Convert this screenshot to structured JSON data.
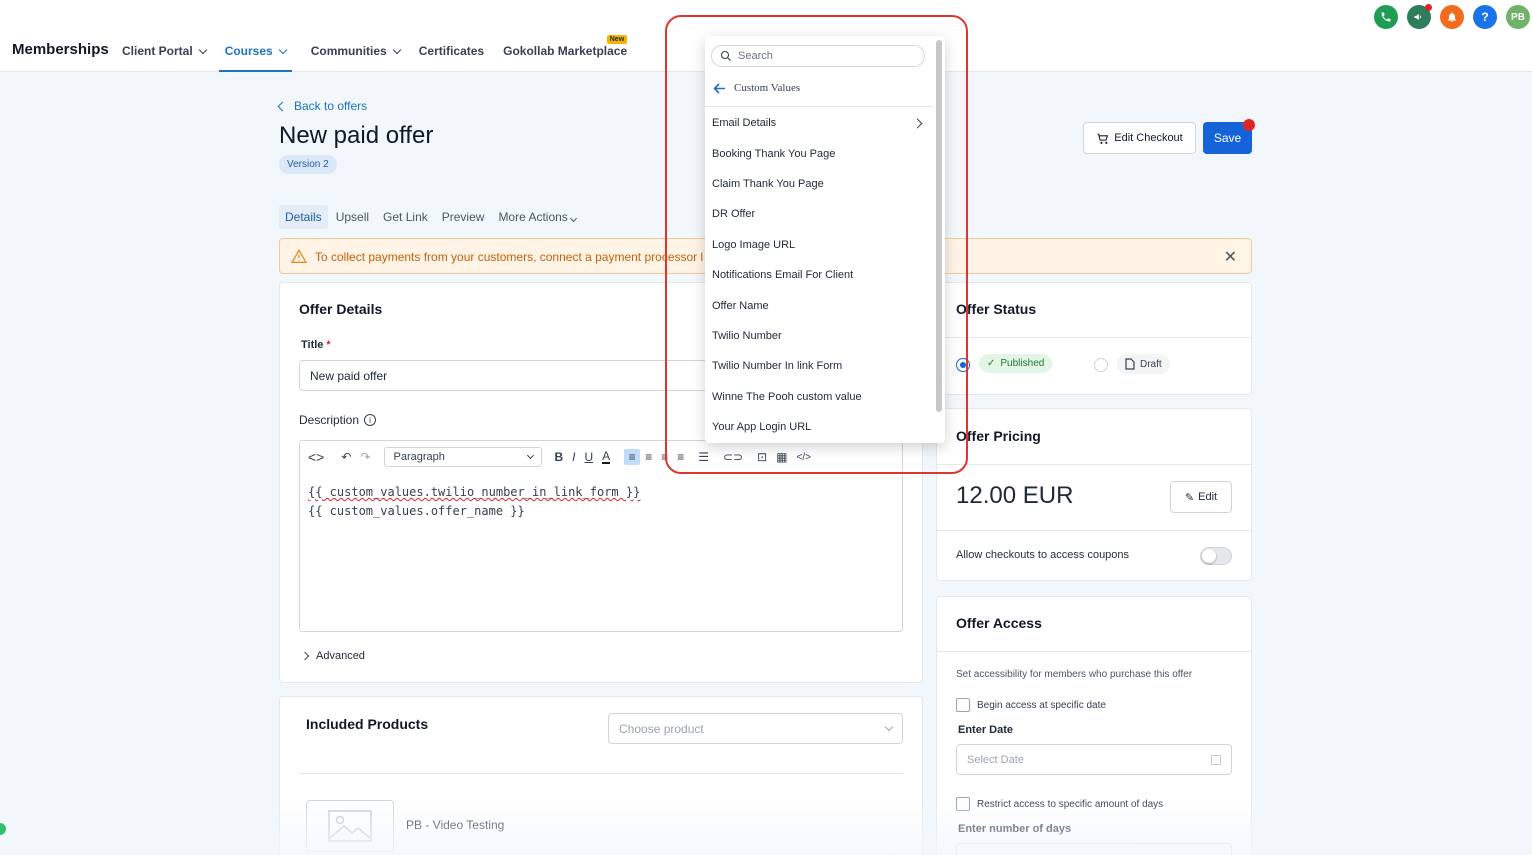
{
  "nav": {
    "brand": "Memberships",
    "items": [
      {
        "label": "Client Portal",
        "has_caret": true
      },
      {
        "label": "Courses",
        "has_caret": true,
        "active": true
      },
      {
        "label": "Communities",
        "has_caret": true
      },
      {
        "label": "Certificates"
      },
      {
        "label": "Gokollab Marketplace",
        "badge": "New"
      }
    ]
  },
  "top_icons": {
    "avatar_initials": "PB",
    "help_glyph": "?"
  },
  "header": {
    "back_label": "Back to offers",
    "title": "New paid offer",
    "version": "Version 2",
    "edit_checkout_label": "Edit Checkout",
    "save_label": "Save"
  },
  "tabs": [
    "Details",
    "Upsell",
    "Get Link",
    "Preview",
    "More Actions"
  ],
  "alert": {
    "text": "To collect payments from your customers, connect a payment processor l"
  },
  "offer_details": {
    "heading": "Offer Details",
    "title_label": "Title",
    "title_value": "New paid offer",
    "description_label": "Description",
    "paragraph_select": "Paragraph",
    "editor_lines": [
      "{{ custom_values.twilio_number_in_link_form }}",
      "{{ custom_values.offer_name }}"
    ],
    "advanced_label": "Advanced"
  },
  "included_products": {
    "heading": "Included Products",
    "placeholder": "Choose product",
    "product_name": "PB - Video Testing"
  },
  "offer_status": {
    "heading": "Offer Status",
    "published_label": "Published",
    "draft_label": "Draft",
    "selected": "Published"
  },
  "offer_pricing": {
    "heading": "Offer Pricing",
    "price": "12.00 EUR",
    "edit_label": "Edit",
    "coupons_label": "Allow checkouts to access coupons",
    "coupons_enabled": false
  },
  "offer_access": {
    "heading": "Offer Access",
    "description": "Set accessibility for members who purchase this offer",
    "begin_access_label": "Begin access at specific date",
    "enter_date_label": "Enter Date",
    "date_placeholder": "Select Date",
    "restrict_label": "Restrict access to specific amount of days",
    "days_label": "Enter number of days"
  },
  "dropdown": {
    "search_placeholder": "Search",
    "back_label": "Custom  Values",
    "items": [
      {
        "label": "Email Details",
        "has_submenu": true
      },
      {
        "label": "Booking Thank You Page"
      },
      {
        "label": "Claim Thank You Page"
      },
      {
        "label": "DR Offer"
      },
      {
        "label": "Logo Image URL"
      },
      {
        "label": "Notifications Email For Client"
      },
      {
        "label": "Offer Name"
      },
      {
        "label": "Twilio Number"
      },
      {
        "label": "Twilio Number In link Form"
      },
      {
        "label": "Winne The Pooh custom value"
      },
      {
        "label": "Your App Login URL"
      }
    ]
  },
  "colors": {
    "primary": "#1563d8",
    "link": "#1d72c4",
    "highlight": "#e0352f",
    "warning_text": "#c4620b"
  }
}
